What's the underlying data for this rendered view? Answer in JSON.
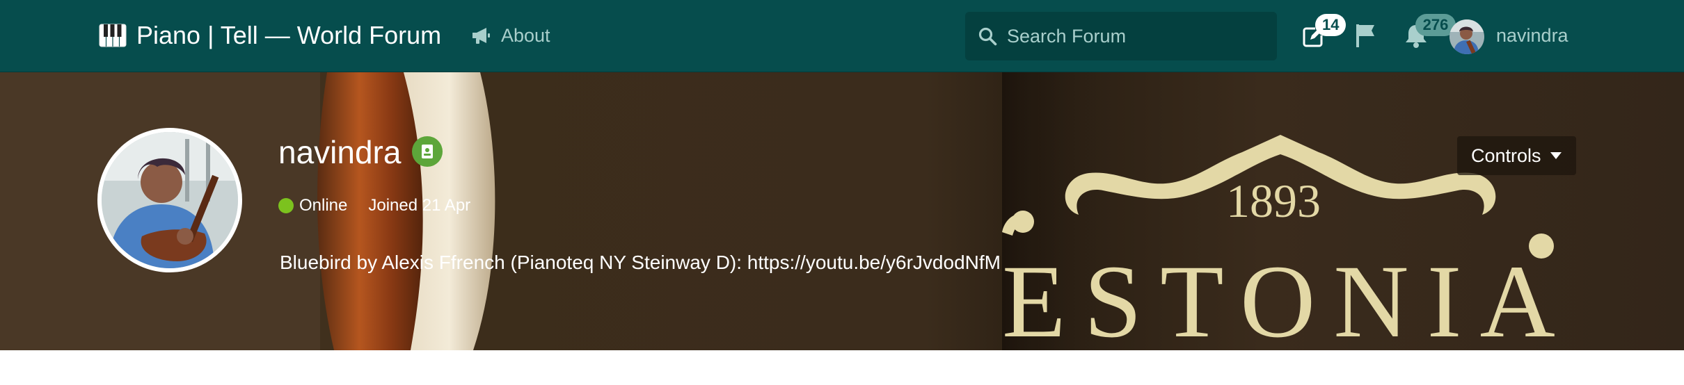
{
  "header": {
    "brand_icon": "piano-keys-icon",
    "site_title": "Piano | Tell — World Forum",
    "about_label": "About",
    "search_placeholder": "Search Forum",
    "compose_count": "14",
    "notifications_count": "276",
    "username": "navindra",
    "colors": {
      "background": "#064d4d",
      "search_bg": "#04403f",
      "muted_text": "#a9cfcc"
    }
  },
  "profile": {
    "username": "navindra",
    "status": "Online",
    "joined": "Joined 21 Apr",
    "bio": "Bluebird by Alexis Ffrench (Pianoteq NY Steinway D): https://youtu.be/y6rJvdodNfM",
    "controls_label": "Controls",
    "banner_text": {
      "year": "1893",
      "brand": "ESTONIA"
    },
    "colors": {
      "online": "#7cc21e",
      "verified_badge": "#5da63a",
      "banner_lettering": "#e3d8a6"
    }
  }
}
